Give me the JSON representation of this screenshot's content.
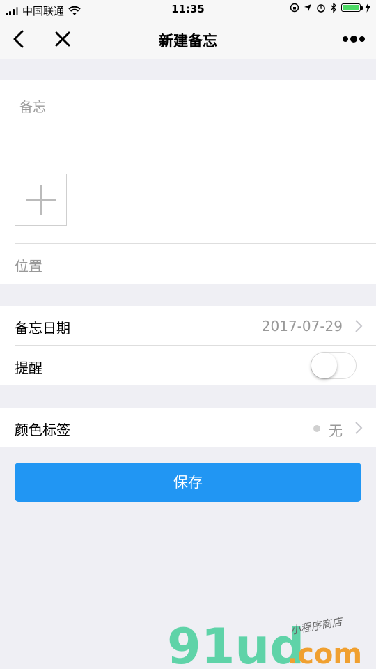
{
  "status_bar": {
    "carrier": "中国联通",
    "time": "11:35"
  },
  "nav": {
    "title": "新建备忘"
  },
  "memo": {
    "placeholder": "备忘",
    "location_placeholder": "位置"
  },
  "settings": {
    "date_label": "备忘日期",
    "date_value": "2017-07-29",
    "reminder_label": "提醒",
    "reminder_on": false,
    "color_label": "颜色标签",
    "color_value": "无"
  },
  "actions": {
    "save_label": "保存"
  },
  "watermark": {
    "brand": "91ud",
    "domain": ".com",
    "tagline": "小程序商店"
  },
  "colors": {
    "accent": "#2196f3",
    "background": "#efeff4",
    "battery": "#4cd964",
    "watermark_brand": "#5fd3a8",
    "watermark_domain": "#f0a030"
  }
}
